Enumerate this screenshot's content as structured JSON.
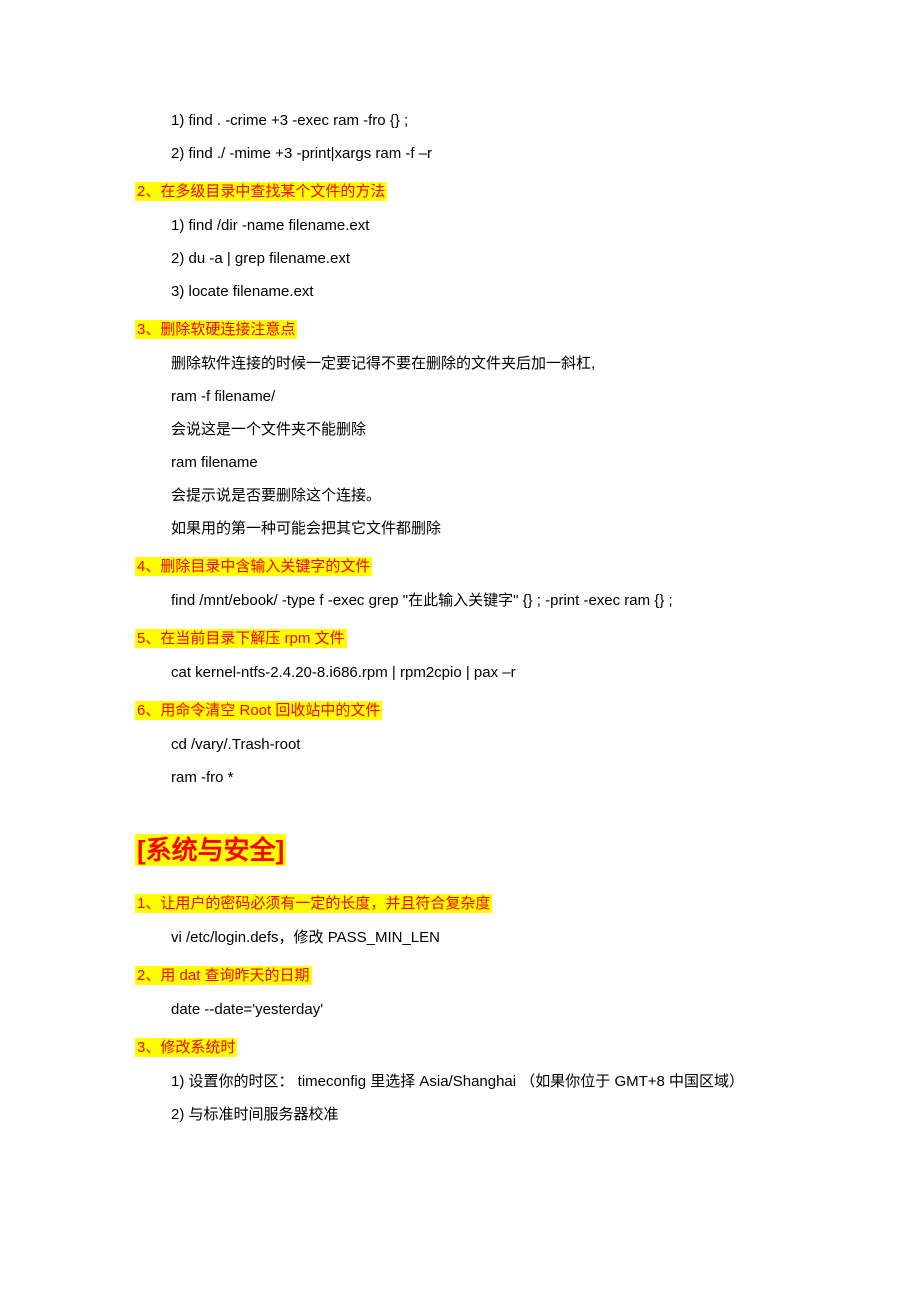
{
  "lines": {
    "l1": "1) find . -crime +3 -exec ram -fro {} ;",
    "l2": "2) find ./ -mime +3 -print|xargs ram -f –r",
    "h2": "2、在多级目录中查找某个文件的方法",
    "l3": "1) find /dir -name filename.ext",
    "l4": "2) du -a | grep filename.ext",
    "l5": "3) locate filename.ext",
    "h3": "3、删除软硬连接注意点",
    "l6": "删除软件连接的时候一定要记得不要在删除的文件夹后加一斜杠,",
    "l7": "ram -f filename/",
    "l8": "会说这是一个文件夹不能删除",
    "l9": "ram filename",
    "l10": "会提示说是否要删除这个连接。",
    "l11": "如果用的第一种可能会把其它文件都删除",
    "h4": "4、删除目录中含输入关键字的文件",
    "l12": "find /mnt/ebook/ -type f -exec grep \"在此输入关键字\" {} ; -print -exec ram {} ;",
    "h5": "5、在当前目录下解压 rpm 文件",
    "l13": "cat kernel-ntfs-2.4.20-8.i686.rpm | rpm2cpio | pax –r",
    "h6": "6、用命令清空 Root 回收站中的文件",
    "l14": "cd /vary/.Trash-root",
    "l15": "ram -fro *",
    "bigh": "[系统与安全]",
    "sh1": "1、让用户的密码必须有一定的长度，并且符合复杂度",
    "sl1": "vi /etc/login.defs，修改  PASS_MIN_LEN",
    "sh2": "2、用 dat 查询昨天的日期",
    "sl2": "date --date='yesterday'",
    "sh3": "3、修改系统时",
    "sl3a": "1)  设置你的时区：  timeconfig  里选择 Asia/Shanghai  （如果你位于  GMT+8  中国区域）",
    "sl3b": "2) 与标准时间服务器校准"
  }
}
